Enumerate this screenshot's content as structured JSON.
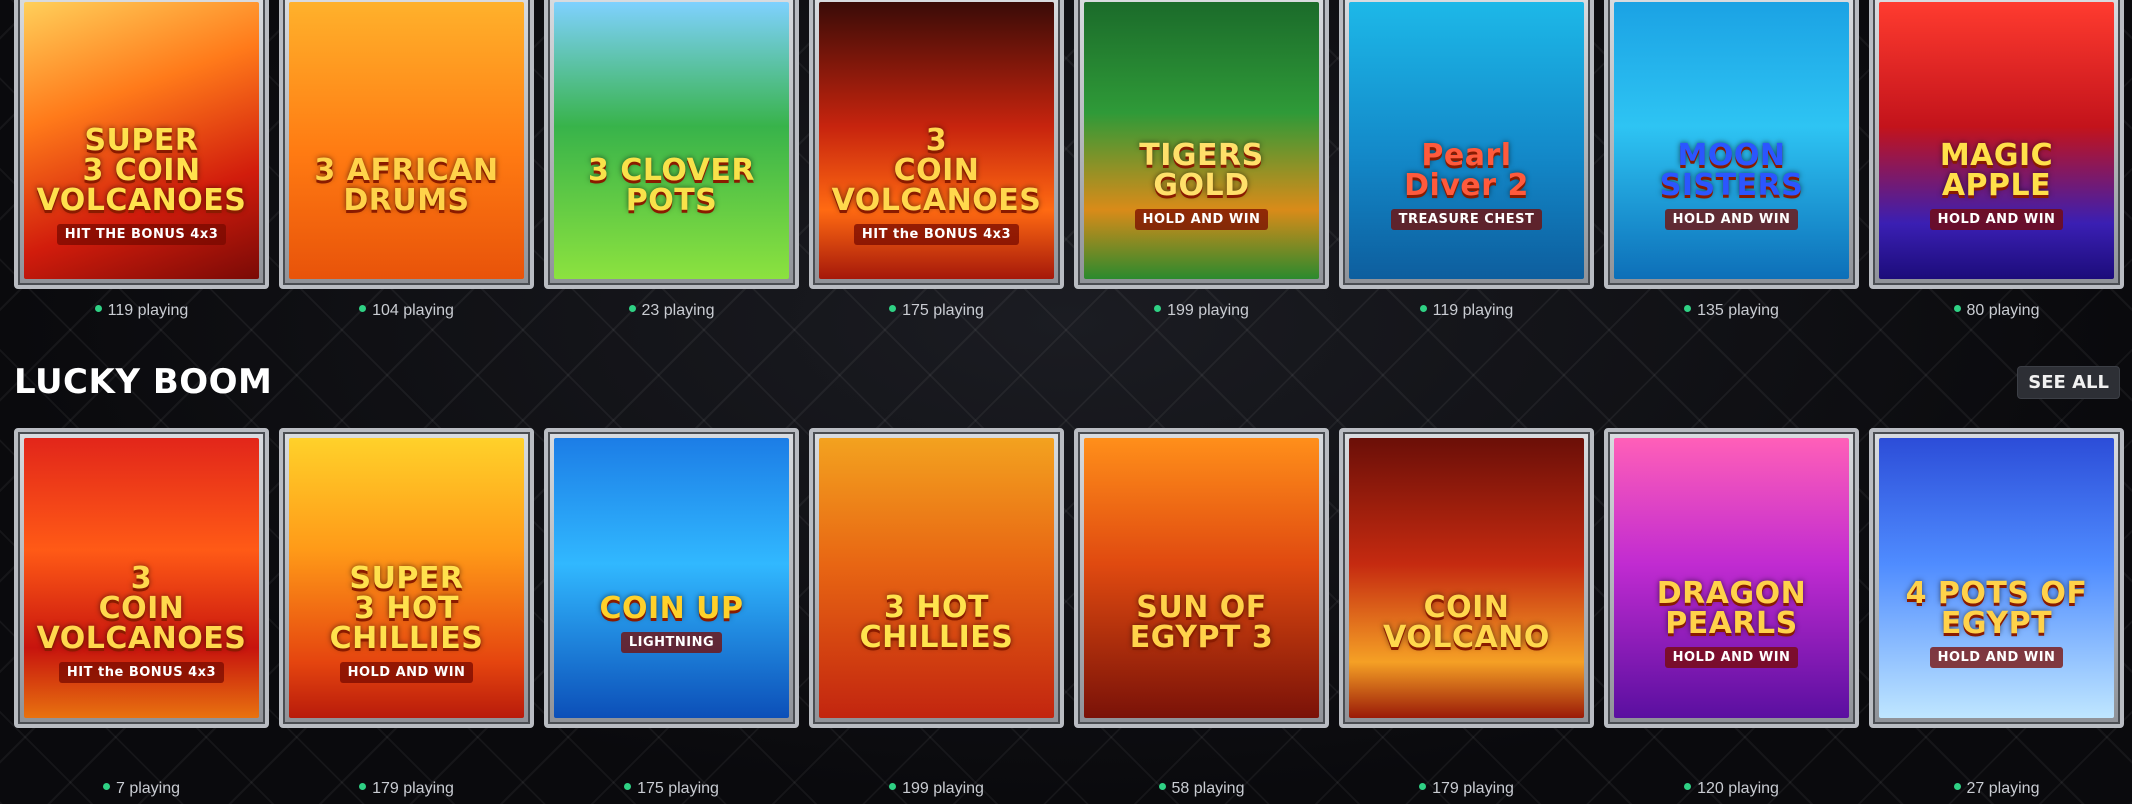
{
  "top_row": [
    {
      "title": "SUPER\n3 COIN\nVOLCANOES",
      "subtitle": "HIT THE BONUS 4x3",
      "playing": "119 playing",
      "bg": "linear-gradient(160deg,#ffcf5a 0%,#ff7a1a 35%,#d11c0c 70%,#7a0a06 100%)",
      "title_color": "#ffe14d"
    },
    {
      "title": "3 AFRICAN\nDRUMS",
      "subtitle": "",
      "playing": "104 playing",
      "bg": "linear-gradient(180deg,#ffb12b 0%,#ff7a12 55%,#e8530a 100%)",
      "title_color": "#ffd34a"
    },
    {
      "title": "3 CLOVER\nPOTS",
      "subtitle": "",
      "playing": "23 playing",
      "bg": "linear-gradient(180deg,#7fd1ff 0%,#38b34a 45%,#8ce23f 100%)",
      "title_color": "#f8e24a"
    },
    {
      "title": "3\nCOIN\nVOLCANOES",
      "subtitle": "HIT the BONUS 4x3",
      "playing": "175 playing",
      "bg": "linear-gradient(180deg,#3a0b07 0%,#c7240e 45%,#ff6a12 75%,#a5180a 100%)",
      "title_color": "#ffd84d"
    },
    {
      "title": "TIGERS\nGOLD",
      "subtitle": "HOLD AND WIN",
      "playing": "199 playing",
      "bg": "linear-gradient(180deg,#1b6b2a 0%,#2f9a38 40%,#d98b19 75%,#2b8a2e 100%)",
      "title_color": "#ffe06a"
    },
    {
      "title": "Pearl\nDiver 2",
      "subtitle": "TREASURE CHEST",
      "playing": "119 playing",
      "bg": "linear-gradient(180deg,#1db8e8 0%,#1389c9 55%,#0d5e9e 100%)",
      "title_color": "#ff5a3c"
    },
    {
      "title": "MOON\nSISTERS",
      "subtitle": "HOLD AND WIN",
      "playing": "135 playing",
      "bg": "linear-gradient(180deg,#1ba2e4 0%,#2ec4f3 45%,#0d6fb8 100%)",
      "title_color": "#2b56ff"
    },
    {
      "title": "MAGIC APPLE",
      "subtitle": "HOLD AND WIN",
      "playing": "80 playing",
      "bg": "linear-gradient(180deg,#ff3b2f 0%,#c3131b 45%,#3a1fb3 80%,#1c0c7a 100%)",
      "title_color": "#ffe04a"
    }
  ],
  "section": {
    "title": "LUCKY BOOM",
    "see_all": "SEE ALL"
  },
  "bottom_row": [
    {
      "title": "3\nCOIN\nVOLCANOES",
      "subtitle": "HIT the BONUS 4x3",
      "playing": "7 playing",
      "bg": "linear-gradient(180deg,#e2261a 0%,#ff5a16 40%,#c7140e 75%,#e8720f 100%)",
      "title_color": "#ffd84d"
    },
    {
      "title": "SUPER\n3 HOT\nCHILLIES",
      "subtitle": "HOLD AND WIN",
      "playing": "179 playing",
      "bg": "linear-gradient(180deg,#ffd12a 0%,#ff9a18 40%,#e5450f 80%,#b81b0b 100%)",
      "title_color": "#ffe14d"
    },
    {
      "title": "COIN UP",
      "subtitle": "LIGHTNING",
      "playing": "175 playing",
      "bg": "linear-gradient(180deg,#1c7de6 0%,#31b8ff 45%,#0c4fb8 100%)",
      "title_color": "#ffd12a"
    },
    {
      "title": "3 HOT\nCHILLIES",
      "subtitle": "",
      "playing": "199 playing",
      "bg": "linear-gradient(180deg,#f3a21f 0%,#e86613 45%,#c2250f 100%)",
      "title_color": "#ffe34d"
    },
    {
      "title": "SUN OF\nEGYPT 3",
      "subtitle": "",
      "playing": "58 playing",
      "bg": "linear-gradient(180deg,#ff8f1a 0%,#e04a10 45%,#7a1208 100%)",
      "title_color": "#ffd24a"
    },
    {
      "title": "COIN\nVOLCANO",
      "subtitle": "",
      "playing": "179 playing",
      "bg": "linear-gradient(180deg,#6b0f08 0%,#c52a10 45%,#f5a025 80%,#9a1a08 100%)",
      "title_color": "#ffd84d"
    },
    {
      "title": "DRAGON\nPEARLS",
      "subtitle": "HOLD AND WIN",
      "playing": "120 playing",
      "bg": "linear-gradient(180deg,#ff5fb8 0%,#c12bd1 45%,#5a0fa0 100%)",
      "title_color": "#ffd24a"
    },
    {
      "title": "4 POTS OF EGYPT",
      "subtitle": "HOLD AND WIN",
      "playing": "27 playing",
      "bg": "linear-gradient(180deg,#2c4dd8 0%,#4f8cff 45%,#bfe6ff 100%)",
      "title_color": "#ffd24a"
    }
  ]
}
